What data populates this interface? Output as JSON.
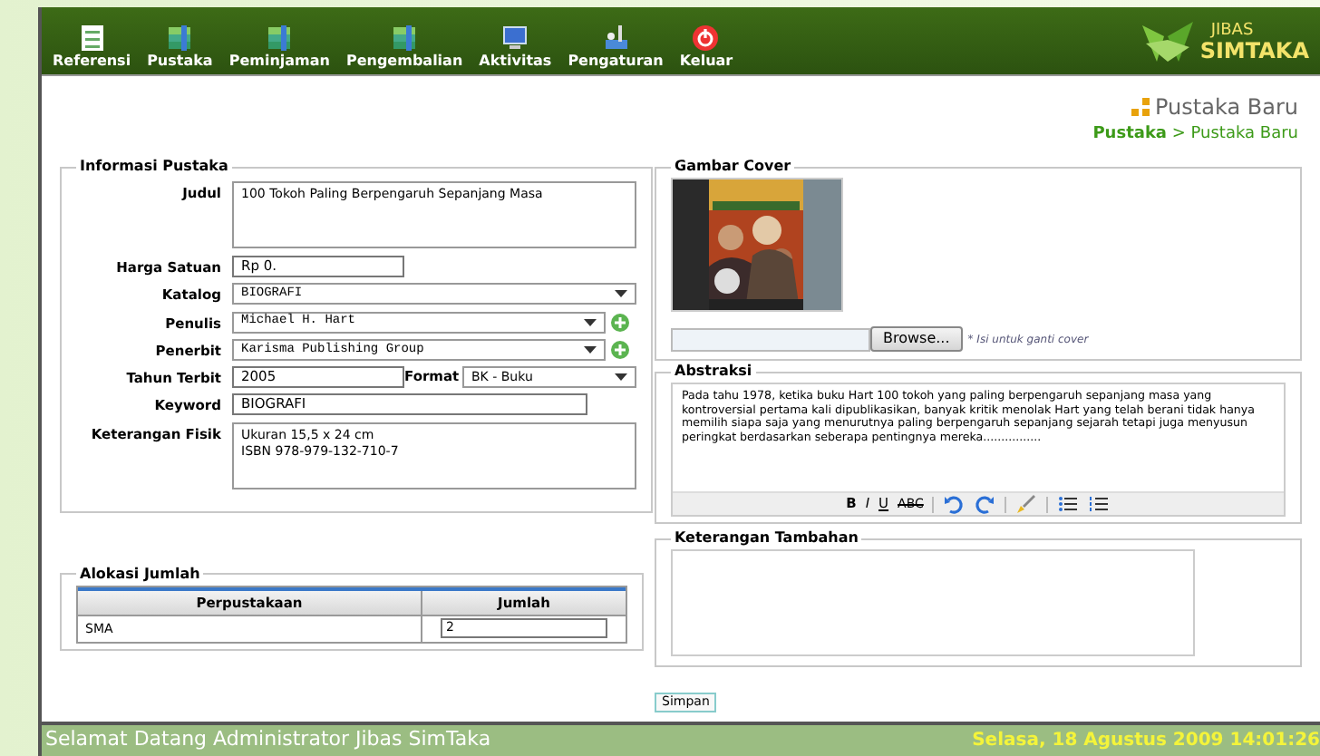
{
  "menu": [
    {
      "label": "Referensi"
    },
    {
      "label": "Pustaka"
    },
    {
      "label": "Peminjaman"
    },
    {
      "label": "Pengembalian"
    },
    {
      "label": "Aktivitas"
    },
    {
      "label": "Pengaturan"
    },
    {
      "label": "Keluar"
    }
  ],
  "logo": {
    "top": "JIBAS",
    "bottom": "SIMTAKA"
  },
  "page_title": "Pustaka Baru",
  "breadcrumb": {
    "parent": "Pustaka",
    "separator": ">",
    "current": "Pustaka Baru"
  },
  "info": {
    "legend": "Informasi Pustaka",
    "fields": [
      {
        "label": "Judul",
        "kind": "textarea",
        "value": "100 Tokoh Paling Berpengaruh Sepanjang Masa"
      },
      {
        "label": "Harga Satuan",
        "kind": "short",
        "value": "Rp 0."
      },
      {
        "label": "Katalog",
        "kind": "select",
        "value": "BIOGRAFI",
        "add": false
      },
      {
        "label": "Penulis",
        "kind": "select",
        "value": "Michael H. Hart",
        "add": true
      },
      {
        "label": "Penerbit",
        "kind": "select",
        "value": "Karisma Publishing Group",
        "add": true
      },
      {
        "label": "Tahun Terbit",
        "kind": "year",
        "value": "2005",
        "extra_label": "Format",
        "extra_value": "BK - Buku"
      },
      {
        "label": "Keyword",
        "kind": "text",
        "value": "BIOGRAFI"
      },
      {
        "label": "Keterangan Fisik",
        "kind": "textarea",
        "value": "Ukuran 15,5 x 24 cm\nISBN 978-979-132-710-7"
      }
    ]
  },
  "allocation": {
    "legend": "Alokasi Jumlah",
    "columns": [
      "Perpustakaan",
      "Jumlah"
    ],
    "rows": [
      {
        "library": "SMA",
        "amount": "2"
      }
    ]
  },
  "cover": {
    "legend": "Gambar Cover",
    "button": "Browse...",
    "hint": "* Isi untuk ganti cover"
  },
  "abstract": {
    "legend": "Abstraksi",
    "text": "Pada tahu 1978, ketika buku Hart 100 tokoh yang paling berpengaruh sepanjang masa yang kontroversial pertama kali dipublikasikan, banyak kritik menolak Hart yang telah berani tidak hanya memilih siapa saja yang menurutnya paling berpengaruh sepanjang sejarah tetapi juga menyusun peringkat berdasarkan seberapa pentingnya mereka................",
    "toolbar": [
      {
        "kind": "bold",
        "label": "B"
      },
      {
        "kind": "italic",
        "label": "I"
      },
      {
        "kind": "underline",
        "label": "U"
      },
      {
        "kind": "strike",
        "label": "ABC"
      },
      {
        "kind": "separator"
      },
      {
        "kind": "undo"
      },
      {
        "kind": "redo"
      },
      {
        "kind": "separator"
      },
      {
        "kind": "brush"
      },
      {
        "kind": "separator"
      },
      {
        "kind": "bullets"
      },
      {
        "kind": "numbers"
      }
    ]
  },
  "extra": {
    "legend": "Keterangan Tambahan"
  },
  "save_button": "Simpan",
  "status_bar": {
    "welcome": "Selamat Datang Administrator Jibas SimTaka",
    "datetime": "Selasa, 18 Agustus 2009 14:01:26"
  }
}
